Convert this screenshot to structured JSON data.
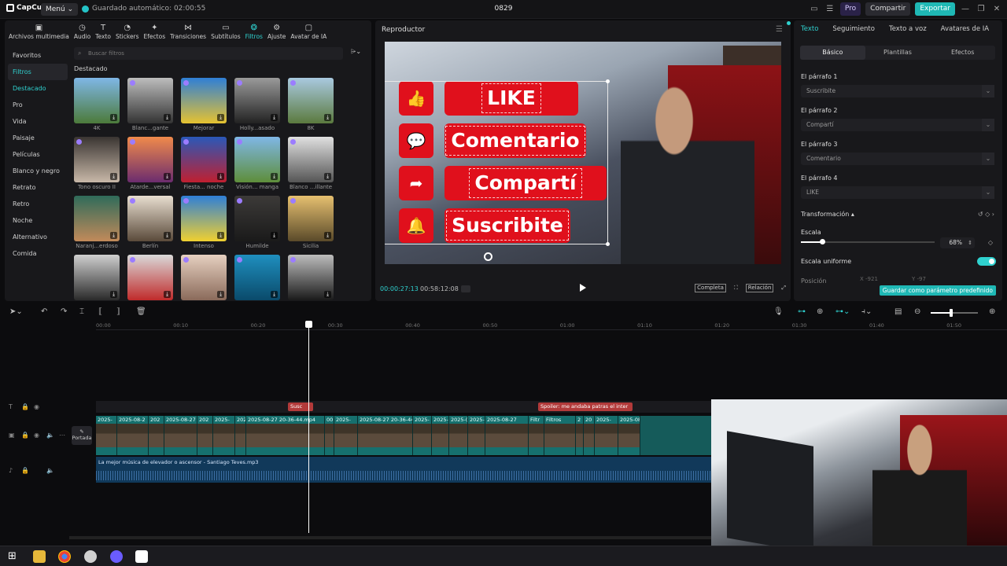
{
  "app": {
    "logo": "CapCut",
    "menu_label": "Menú",
    "autosave": "Guardado automático: 02:00:55",
    "title": "0829",
    "pro_label": "Pro",
    "share_label": "Compartir",
    "export_label": "Exportar"
  },
  "toolbar": {
    "items": [
      {
        "label": "Archivos multimedia",
        "icon": "media-icon"
      },
      {
        "label": "Audio",
        "icon": "audio-icon"
      },
      {
        "label": "Texto",
        "icon": "text-icon"
      },
      {
        "label": "Stickers",
        "icon": "sticker-icon"
      },
      {
        "label": "Efectos",
        "icon": "effects-icon"
      },
      {
        "label": "Transiciones",
        "icon": "transition-icon"
      },
      {
        "label": "Subtítulos",
        "icon": "subtitle-icon"
      },
      {
        "label": "Filtros",
        "icon": "filter-icon"
      },
      {
        "label": "Ajuste",
        "icon": "adjust-icon"
      },
      {
        "label": "Avatar de IA",
        "icon": "avatar-icon"
      }
    ],
    "active_index": 7
  },
  "filters": {
    "categories": [
      "Favoritos",
      "Filtros",
      "Destacado",
      "Pro",
      "Vida",
      "Paisaje",
      "Películas",
      "Blanco y negro",
      "Retrato",
      "Retro",
      "Noche",
      "Alternativo",
      "Comida"
    ],
    "search_placeholder": "Buscar filtros",
    "section_title": "Destacado",
    "items": [
      {
        "label": "4K",
        "colors": [
          "#7fb7e6",
          "#4c7a3a"
        ]
      },
      {
        "label": "Blanc...gante",
        "colors": [
          "#bdbdbd",
          "#333333"
        ]
      },
      {
        "label": "Mejorar",
        "colors": [
          "#2f7fd6",
          "#e6c230"
        ]
      },
      {
        "label": "Holly...asado",
        "colors": [
          "#9a9a9a",
          "#222222"
        ]
      },
      {
        "label": "8K",
        "colors": [
          "#a9c9e0",
          "#5b7a3e"
        ]
      },
      {
        "label": "Tono oscuro II",
        "colors": [
          "#3a3532",
          "#c8b8a8"
        ]
      },
      {
        "label": "Atarde...versal",
        "colors": [
          "#f08a4b",
          "#6b2c6e"
        ]
      },
      {
        "label": "Fiesta... noche",
        "colors": [
          "#2a58b8",
          "#c02030"
        ]
      },
      {
        "label": "Visión... manga",
        "colors": [
          "#7fb7e6",
          "#5e8e3a"
        ]
      },
      {
        "label": "Blanco ...illante",
        "colors": [
          "#e0e0e0",
          "#555555"
        ]
      },
      {
        "label": "Naranj...erdoso",
        "colors": [
          "#2f6b5a",
          "#c28a5a"
        ]
      },
      {
        "label": "Berlín",
        "colors": [
          "#e8ded0",
          "#5a4a3a"
        ]
      },
      {
        "label": "Intenso",
        "colors": [
          "#2f7fd6",
          "#f0d030"
        ]
      },
      {
        "label": "Humilde",
        "colors": [
          "#3c3a38",
          "#1a1a1a"
        ]
      },
      {
        "label": "Sicilia",
        "colors": [
          "#e6c070",
          "#5a4a2a"
        ]
      },
      {
        "label": "",
        "colors": [
          "#cfcfcf",
          "#2a2a2a"
        ]
      },
      {
        "label": "",
        "colors": [
          "#d9d9d9",
          "#c02a2a"
        ]
      },
      {
        "label": "",
        "colors": [
          "#e6d0c0",
          "#8a6a5a"
        ]
      },
      {
        "label": "",
        "colors": [
          "#1f8fbf",
          "#0a4a6a"
        ]
      },
      {
        "label": "",
        "colors": [
          "#bdbdbd",
          "#1a1a1a"
        ]
      }
    ]
  },
  "player": {
    "title": "Reproductor",
    "buttons": [
      {
        "icon": "thumbs-up-icon",
        "glyph": "👍",
        "text": "LIKE"
      },
      {
        "icon": "comment-icon",
        "glyph": "💬",
        "text": "Comentario"
      },
      {
        "icon": "share-arrow-icon",
        "glyph": "➦",
        "text": "Compartí"
      },
      {
        "icon": "bell-icon",
        "glyph": "🔔",
        "text": "Suscribite"
      }
    ],
    "current_time": "00:00:27:13",
    "total_time": "00:58:12:08",
    "full_label": "Completa",
    "ratio_label": "Relación"
  },
  "properties": {
    "tabs": [
      "Texto",
      "Seguimiento",
      "Texto a voz",
      "Avatares de IA"
    ],
    "subtabs": [
      "Básico",
      "Plantillas",
      "Efectos"
    ],
    "paragraphs": [
      {
        "label": "El párrafo 1",
        "value": "Suscribite"
      },
      {
        "label": "El párrafo 2",
        "value": "Compartí"
      },
      {
        "label": "El párrafo 3",
        "value": "Comentario"
      },
      {
        "label": "El párrafo 4",
        "value": "LIKE"
      }
    ],
    "transform_label": "Transformación",
    "scale_label": "Escala",
    "scale_value": "68%",
    "scale_fraction": 0.16,
    "uniform_label": "Escala uniforme",
    "position_label": "Posición",
    "pos_x": "X  -921",
    "pos_y": "Y  -97",
    "save_preset": "Guardar como parámetro predefinido"
  },
  "timeline": {
    "ruler": [
      "00:00",
      "00:10",
      "00:20",
      "00:30",
      "00:40",
      "00:50",
      "01:00",
      "01:10",
      "01:20",
      "01:30",
      "01:40",
      "01:50"
    ],
    "text_clips": [
      {
        "label": "Susc",
        "color": "#b23a3a"
      },
      {
        "label": "Spoiler: me andaba  patras el inter",
        "color": "#b23a3a"
      }
    ],
    "video_clips": [
      "2025-",
      "2025-08-2",
      "202",
      "2025-08-27",
      "202",
      "2025-",
      "202",
      "2025-08-27 20-36-44.mp4",
      "00",
      "2025-",
      "2025-08-27 20-36-44.m",
      "2025-",
      "2025-",
      "2025-(",
      "2025-",
      "2025-08-27",
      "Filtr",
      "Filtros",
      "2",
      "20",
      "2025-",
      "2025-08"
    ],
    "cover_label": "Portada",
    "audio_clip": "La mejor música de elevador o ascensor - Santiago Teves.mp3"
  }
}
